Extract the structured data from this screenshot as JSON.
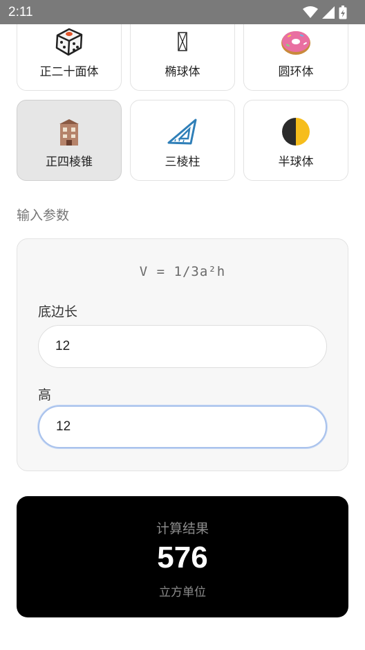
{
  "status_bar": {
    "time": "2:11"
  },
  "shapes": [
    {
      "label": "正二十面体",
      "icon": "dice-icon",
      "selected": false
    },
    {
      "label": "椭球体",
      "icon": "hourglass-icon",
      "selected": false
    },
    {
      "label": "圆环体",
      "icon": "donut-icon",
      "selected": false
    },
    {
      "label": "正四棱锥",
      "icon": "building-icon",
      "selected": true
    },
    {
      "label": "三棱柱",
      "icon": "triangle-ruler-icon",
      "selected": false
    },
    {
      "label": "半球体",
      "icon": "half-circle-icon",
      "selected": false
    }
  ],
  "params": {
    "section_title": "输入参数",
    "formula": "V = 1/3a²h",
    "base_label": "底边长",
    "base_value": "12",
    "height_label": "高",
    "height_value": "12"
  },
  "result": {
    "title": "计算结果",
    "value": "576",
    "unit": "立方单位"
  },
  "colors": {
    "selected_card": "#e6e6e6",
    "result_bg": "#000000",
    "focus_border": "#a9c2ec"
  }
}
